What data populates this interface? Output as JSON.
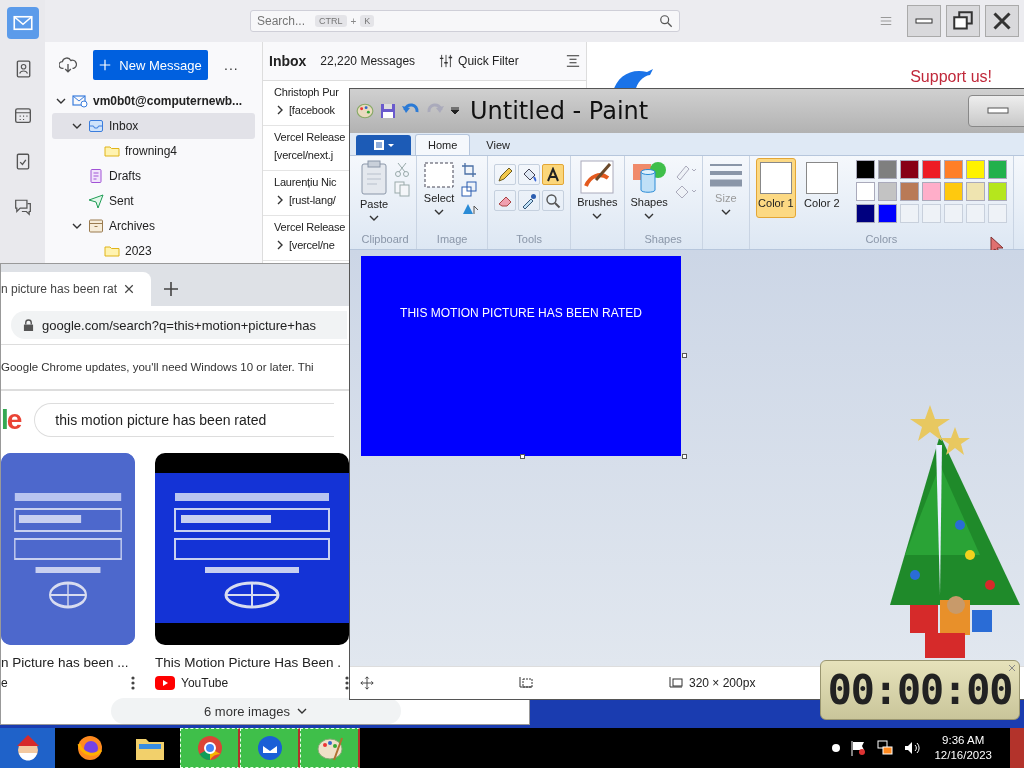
{
  "mail": {
    "spaces": [
      {
        "kind": "mail",
        "selected": true
      },
      {
        "kind": "contacts",
        "selected": false
      },
      {
        "kind": "calendar",
        "selected": false
      },
      {
        "kind": "tasks",
        "selected": false
      },
      {
        "kind": "chat",
        "selected": false
      }
    ],
    "search": {
      "placeholder": "Search...",
      "keys": [
        "CTRL",
        "K"
      ],
      "separator": "+"
    },
    "new_message": "New Message",
    "more": "...",
    "account": {
      "name": "vm0b0t@computernewb...",
      "kind": "account",
      "selected": false,
      "expanded": true,
      "children": [
        {
          "name": "Inbox",
          "kind": "inbox",
          "selected": true,
          "expanded": true,
          "children": [
            {
              "name": "frowning4",
              "kind": "folder",
              "selected": false
            }
          ]
        },
        {
          "name": "Drafts",
          "kind": "drafts",
          "selected": false
        },
        {
          "name": "Sent",
          "kind": "sent",
          "selected": false
        },
        {
          "name": "Archives",
          "kind": "archive",
          "selected": false,
          "expanded": true,
          "children": [
            {
              "name": "2023",
              "kind": "folder",
              "selected": false
            }
          ]
        }
      ]
    },
    "list_title": "Inbox",
    "message_count": "22,220 Messages",
    "quick_filter": "Quick Filter",
    "messages": [
      {
        "sender": "Christoph Pur",
        "subject": "[facebook",
        "thread": true
      },
      {
        "sender": "Vercel Release",
        "subject": "[vercel/next.j",
        "thread": false
      },
      {
        "sender": "Laurențiu Nic",
        "subject": "[rust-lang/",
        "thread": true
      },
      {
        "sender": "Vercel Release",
        "subject": "[vercel/ne",
        "thread": true
      }
    ],
    "support": "Support us!"
  },
  "browser": {
    "tab_title": "n picture has been rat",
    "url": "google.com/search?q=this+motion+picture+has",
    "banner": "Google Chrome updates, you'll need Windows 10 or later. Thi",
    "logo": "le",
    "query": "this motion picture has been rated",
    "results": [
      {
        "title": "n Picture has been ...",
        "source": "e",
        "kind": "page"
      },
      {
        "title": "This Motion Picture Has Been .",
        "source": "YouTube",
        "kind": "video"
      }
    ],
    "more_images": "6 more images"
  },
  "paint": {
    "title": "Untitled - Paint",
    "tabs": [
      {
        "label": "Home",
        "selected": true
      },
      {
        "label": "View",
        "selected": false
      }
    ],
    "groups": [
      {
        "kind": "clipboard",
        "label": "Clipboard",
        "button": "Paste"
      },
      {
        "label": "Image",
        "button": "Select"
      },
      {
        "kind": "tools",
        "label": "Tools",
        "tools": [
          {
            "kind": "pencil",
            "selected": false
          },
          {
            "kind": "fill",
            "selected": false
          },
          {
            "kind": "text",
            "selected": true
          },
          {
            "kind": "eraser",
            "selected": false
          },
          {
            "kind": "picker",
            "selected": false
          },
          {
            "kind": "magnifier",
            "selected": false
          }
        ]
      },
      {
        "kind": "brushes",
        "button": "Brushes"
      },
      {
        "kind": "shapes",
        "label": "Shapes",
        "button": "Shapes"
      },
      {
        "kind": "size",
        "button": "Size",
        "disabled": true
      },
      {
        "kind": "colors",
        "label": "Colors",
        "slots": [
          {
            "label": "Color 1",
            "selected": true
          },
          {
            "label": "Color 2",
            "selected": false
          }
        ],
        "palette": [
          {
            "kind": "color",
            "color": "#000000"
          },
          {
            "kind": "color",
            "color": "#7f7f7f"
          },
          {
            "kind": "color",
            "color": "#880015"
          },
          {
            "kind": "color",
            "color": "#ed1c24"
          },
          {
            "kind": "color",
            "color": "#ff7f27"
          },
          {
            "kind": "color",
            "color": "#fff200"
          },
          {
            "kind": "color",
            "color": "#22b14c"
          },
          {
            "kind": "color",
            "color": "#ffffff"
          },
          {
            "kind": "color",
            "color": "#c3c3c3"
          },
          {
            "kind": "color",
            "color": "#b97a57"
          },
          {
            "kind": "color",
            "color": "#ffaec9"
          },
          {
            "kind": "color",
            "color": "#ffc90e"
          },
          {
            "kind": "color",
            "color": "#efe4b0"
          },
          {
            "kind": "color",
            "color": "#b5e61d"
          },
          {
            "kind": "color",
            "color": "#00007f"
          },
          {
            "kind": "color",
            "color": "#0000ff"
          },
          {
            "kind": "empty"
          },
          {
            "kind": "empty"
          },
          {
            "kind": "empty"
          },
          {
            "kind": "empty"
          },
          {
            "kind": "empty"
          }
        ]
      }
    ],
    "canvas_text": "THIS MOTION PICTURE HAS BEEN RATED",
    "canvas_size": "320 × 200px"
  },
  "timer": "00:00:00",
  "taskbar": {
    "apps": [
      {
        "kind": "santa",
        "active": false
      },
      {
        "kind": "firefox",
        "active": false
      },
      {
        "kind": "explorer",
        "active": false
      },
      {
        "kind": "chrome",
        "active": true
      },
      {
        "kind": "mail",
        "active": true
      },
      {
        "kind": "paint",
        "active": true
      }
    ],
    "time": "9:36 AM",
    "date": "12/16/2023"
  }
}
